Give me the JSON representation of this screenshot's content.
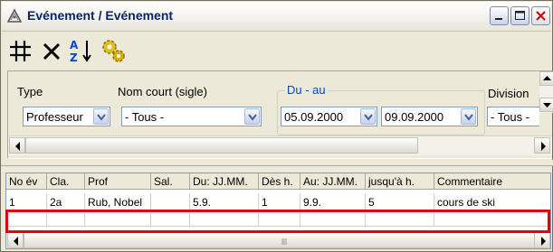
{
  "window": {
    "title": "Evénement / Evénement",
    "accent": "#0a246a"
  },
  "toolbar": {
    "items": [
      {
        "name": "new-record",
        "icon": "grid-hash-icon"
      },
      {
        "name": "delete-record",
        "icon": "x-icon"
      },
      {
        "name": "sort-az",
        "icon": "sort-az-icon"
      },
      {
        "name": "options",
        "icon": "gears-icon"
      }
    ]
  },
  "filters": {
    "type_label": "Type",
    "type_value": "Professeur",
    "short_name_label": "Nom court (sigle)",
    "short_name_value": "- Tous -",
    "date_group_label": "Du - au",
    "date_from": "05.09.2000",
    "date_to": "09.09.2000",
    "division_label": "Division",
    "division_value": "- Tous -"
  },
  "grid": {
    "columns": [
      "No év",
      "Cla.",
      "Prof",
      "Sal.",
      "Du: JJ.MM.",
      "Dès h.",
      "Au: JJ.MM.",
      "jusqu'à h.",
      "Commentaire"
    ],
    "rows": [
      [
        "1",
        "2a",
        "Rub, Nobel",
        "",
        "5.9.",
        "1",
        "9.9.",
        "5",
        "cours de ski"
      ]
    ],
    "highlight_color": "#e5000f"
  }
}
